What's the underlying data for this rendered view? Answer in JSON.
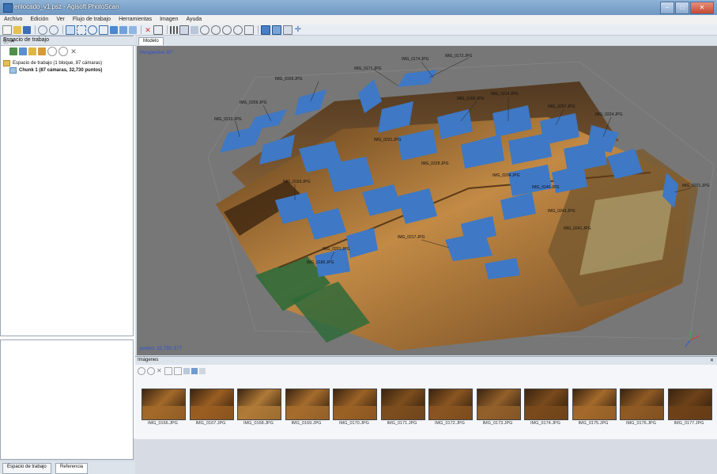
{
  "window": {
    "title": "enlocado_v1.psz - Agisoft PhotoScan",
    "min_label": "–",
    "max_label": "□",
    "close_label": "✕"
  },
  "menu": [
    "Archivo",
    "Edición",
    "Ver",
    "Flujo de trabajo",
    "Herramientas",
    "Imagen",
    "Ayuda"
  ],
  "workspace": {
    "title": "Espacio de trabajo",
    "controls": "ⓟ ✕",
    "root_label": "Espacio de trabajo (1 bloque, 87 cámaras)",
    "chunk_label": "Chunk 1 (87 cámaras, 32,730 puntos)"
  },
  "bottom_tabs": {
    "workspace": "Espacio de trabajo",
    "reference": "Referencia"
  },
  "model_tab": "Modelo",
  "viewport": {
    "perspective_label": "Perspective 30°",
    "points_label": "puntos: 32,730, 577"
  },
  "images_panel": {
    "title": "Imágenes",
    "close": "✕"
  },
  "cameras": [
    {
      "label": "IMG_0171.JPG"
    },
    {
      "label": "IMG_0172.JPG"
    },
    {
      "label": "IMG_0174.JPG"
    },
    {
      "label": "IMG_0166.JPG"
    },
    {
      "label": "IMG_0209.JPG"
    },
    {
      "label": "IMG_0210.JPG"
    },
    {
      "label": "IMG_0169.JPG"
    },
    {
      "label": "IMG_0214.JPG"
    },
    {
      "label": "IMG_0207.JPG"
    },
    {
      "label": "IMG_0224.JPG"
    },
    {
      "label": "IMG_0221.JPG"
    },
    {
      "label": "IMG_0217.JPG"
    },
    {
      "label": "IMG_0193.JPG"
    },
    {
      "label": "IMG_0201.JPG"
    },
    {
      "label": "IMG_0231.JPG"
    },
    {
      "label": "IMG_0228.JPG"
    },
    {
      "label": "IMG_0204.JPG"
    },
    {
      "label": "IMG_0240.JPG"
    },
    {
      "label": "IMG_0243.JPG"
    },
    {
      "label": "IMG_0241.JPG"
    },
    {
      "label": "IMG_0186.JPG"
    }
  ],
  "thumbnails": [
    {
      "label": "IMG_0166.JPG",
      "tone": "#a36a2a"
    },
    {
      "label": "IMG_0167.JPG",
      "tone": "#9a5e22"
    },
    {
      "label": "IMG_0168.JPG",
      "tone": "#b07a37"
    },
    {
      "label": "IMG_0169.JPG",
      "tone": "#a66c2d"
    },
    {
      "label": "IMG_0170.JPG",
      "tone": "#9b6226"
    },
    {
      "label": "IMG_0171.JPG",
      "tone": "#7d4e1e"
    },
    {
      "label": "IMG_0172.JPG",
      "tone": "#8a5521"
    },
    {
      "label": "IMG_0173.JPG",
      "tone": "#93602a"
    },
    {
      "label": "IMG_0174.JPG",
      "tone": "#7a4a1c"
    },
    {
      "label": "IMG_0175.JPG",
      "tone": "#a46a2b"
    },
    {
      "label": "IMG_0176.JPG",
      "tone": "#8f5a24"
    },
    {
      "label": "IMG_0177.JPG",
      "tone": "#6e4219"
    }
  ],
  "colors": {
    "camera_plane": "#3f78c4",
    "point_cloud_warm": "#b8823f",
    "floor_green": "#2f6a3a",
    "viewport_bg": "#777777"
  }
}
